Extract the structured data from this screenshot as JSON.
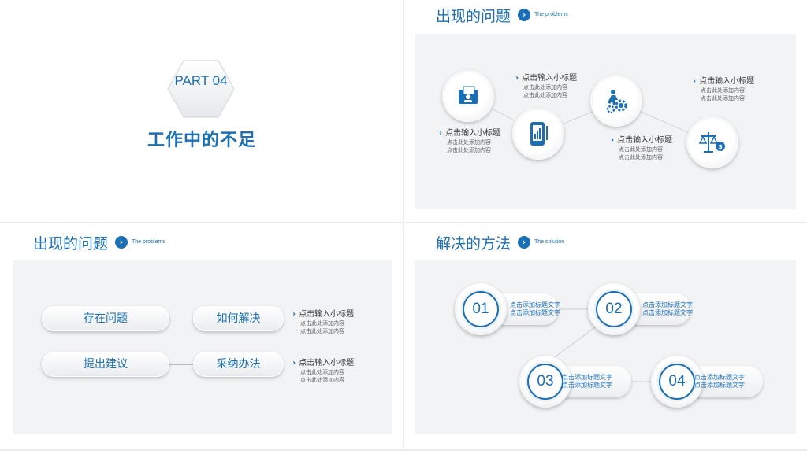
{
  "colors": {
    "accent": "#1a6fb5",
    "panel_bg": "#f2f3f5"
  },
  "p1": {
    "part": "PART 04",
    "title": "工作中的不足"
  },
  "p2": {
    "title": "出现的问题",
    "sub": "The problems",
    "items": [
      {
        "icon": "folder-user-icon",
        "heading": "点击输入小标题",
        "lines": [
          "点击此处添加内容",
          "点击此处添加内容"
        ]
      },
      {
        "icon": "phone-chart-icon",
        "heading": "点击输入小标题",
        "lines": [
          "点击此处添加内容",
          "点击此处添加内容"
        ]
      },
      {
        "icon": "person-gears-icon",
        "heading": "点击输入小标题",
        "lines": [
          "点击此处添加内容",
          "点击此处添加内容"
        ]
      },
      {
        "icon": "scale-money-icon",
        "heading": "点击输入小标题",
        "lines": [
          "点击此处添加内容",
          "点击此处添加内容"
        ]
      }
    ]
  },
  "p3": {
    "title": "出现的问题",
    "sub": "The problems",
    "rows": [
      {
        "left": "存在问题",
        "right": "如何解决",
        "heading": "点击输入小标题",
        "lines": [
          "点击此处添加内容",
          "点击此处添加内容"
        ]
      },
      {
        "left": "提出建议",
        "right": "采纳办法",
        "heading": "点击输入小标题",
        "lines": [
          "点击此处添加内容",
          "点击此处添加内容"
        ]
      }
    ]
  },
  "p4": {
    "title": "解决的方法",
    "sub": "The solution",
    "steps": [
      {
        "num": "01",
        "lines": [
          "点击添加标题文字",
          "点击添加标题文字"
        ]
      },
      {
        "num": "02",
        "lines": [
          "点击添加标题文字",
          "点击添加标题文字"
        ]
      },
      {
        "num": "03",
        "lines": [
          "点击添加标题文字",
          "点击添加标题文字"
        ]
      },
      {
        "num": "04",
        "lines": [
          "点击添加标题文字",
          "点击添加标题文字"
        ]
      }
    ]
  }
}
